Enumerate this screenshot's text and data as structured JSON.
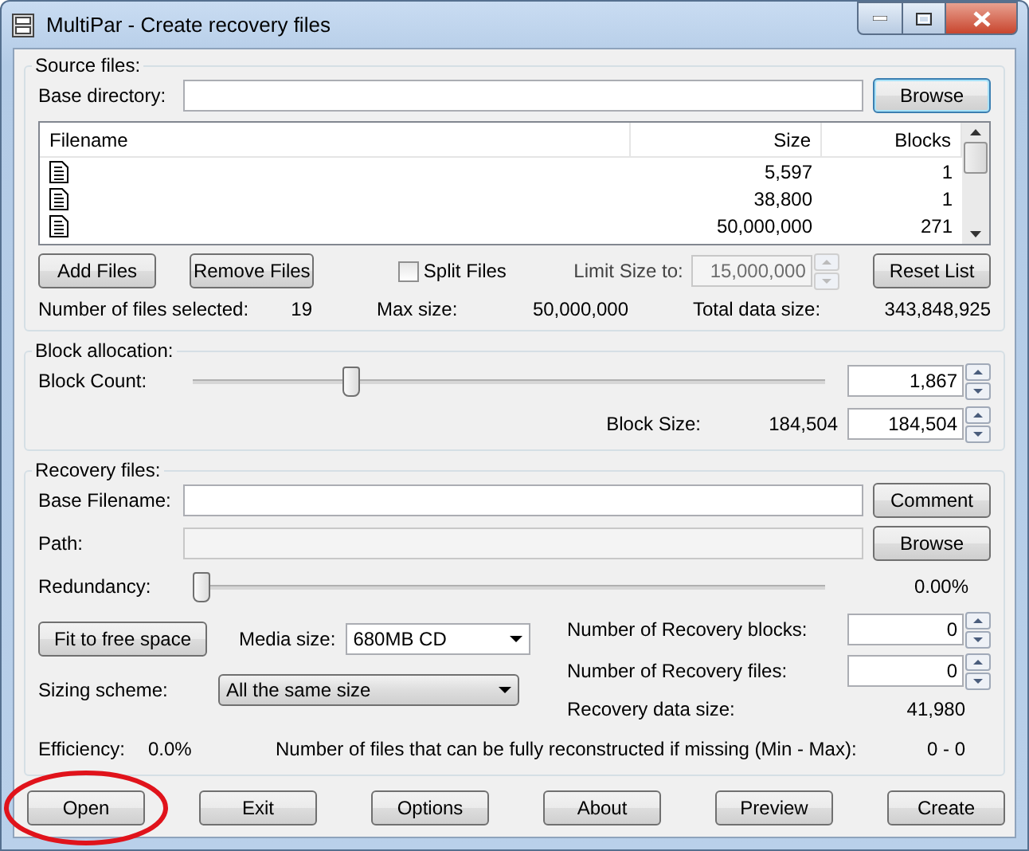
{
  "window": {
    "title": "MultiPar - Create recovery files"
  },
  "source": {
    "title": "Source files:",
    "base_directory": {
      "label": "Base directory:"
    },
    "browse": "Browse",
    "columns": [
      "Filename",
      "Size",
      "Blocks"
    ],
    "rows": [
      {
        "size": "5,597",
        "blocks": "1"
      },
      {
        "size": "38,800",
        "blocks": "1"
      },
      {
        "size": "50,000,000",
        "blocks": "271"
      }
    ],
    "add_files": "Add Files",
    "remove_files": "Remove Files",
    "split_files": {
      "label": "Split Files",
      "checked": false
    },
    "limit": {
      "label": "Limit Size to:",
      "value": "15,000,000",
      "disabled": true
    },
    "reset_list": "Reset List",
    "stats": [
      {
        "label": "Number of files selected:",
        "value": "19"
      },
      {
        "label": "Max size:",
        "value": "50,000,000"
      },
      {
        "label": "Total data size:",
        "value": "343,848,925"
      }
    ]
  },
  "block_allocation": {
    "title": "Block allocation:",
    "block_count": {
      "label": "Block Count:",
      "level": 0.25,
      "value": "1,867"
    },
    "block_size": {
      "label": "Block Size:",
      "reading": "184,504",
      "value": "184,504"
    }
  },
  "recovery": {
    "title": "Recovery files:",
    "base_filename": {
      "label": "Base Filename:"
    },
    "comment": "Comment",
    "path": {
      "label": "Path:"
    },
    "browse": "Browse",
    "redundancy": {
      "label": "Redundancy:",
      "level": 0,
      "reading": "0.00%"
    },
    "fit": "Fit to free space",
    "media_size": {
      "label": "Media size:",
      "value": "680MB CD"
    },
    "sizing_scheme": {
      "label": "Sizing scheme:",
      "value": "All the same size"
    },
    "recovery_blocks": {
      "label": "Number of Recovery blocks:",
      "value": "0"
    },
    "recovery_files": {
      "label": "Number of Recovery files:",
      "value": "0"
    },
    "data_size": {
      "label": "Recovery data size:",
      "value": "41,980"
    },
    "efficiency": {
      "label": "Efficiency:",
      "value": "0.0%"
    },
    "reconstruct": {
      "label": "Number of files that can be fully reconstructed if missing (Min - Max):",
      "value": "0 - 0"
    }
  },
  "buttons": [
    {
      "label": "Open",
      "highlighted": true
    },
    {
      "label": "Exit",
      "highlighted": false
    },
    {
      "label": "Options",
      "highlighted": false
    },
    {
      "label": "About",
      "highlighted": false
    },
    {
      "label": "Preview",
      "highlighted": false
    },
    {
      "label": "Create",
      "highlighted": false
    }
  ]
}
